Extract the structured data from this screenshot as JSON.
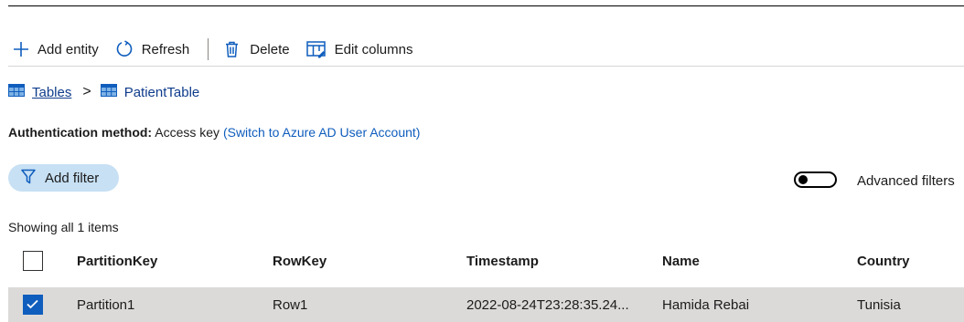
{
  "toolbar": {
    "add_label": "Add entity",
    "refresh_label": "Refresh",
    "delete_label": "Delete",
    "edit_columns_label": "Edit columns"
  },
  "breadcrumb": {
    "root": "Tables",
    "separator": ">",
    "current": "PatientTable"
  },
  "auth": {
    "label": "Authentication method:",
    "value": "Access key",
    "switch_link": "(Switch to Azure AD User Account)"
  },
  "filter": {
    "add_filter_label": "Add filter",
    "advanced_label": "Advanced filters",
    "advanced_on": false
  },
  "table": {
    "summary": "Showing all 1 items",
    "columns": [
      "PartitionKey",
      "RowKey",
      "Timestamp",
      "Name",
      "Country"
    ],
    "rows": [
      {
        "selected": true,
        "cells": [
          "Partition1",
          "Row1",
          "2022-08-24T23:28:35.24...",
          "Hamida Rebai",
          "Tunisia"
        ]
      }
    ]
  },
  "icons": {
    "add": "plus-icon",
    "refresh": "refresh-icon",
    "delete": "trash-icon",
    "edit_columns": "edit-columns-icon",
    "table": "table-icon",
    "filter": "filter-icon",
    "check": "checkmark-icon"
  },
  "colors": {
    "accent": "#0f5dbd",
    "link": "#0f3c8c",
    "pill_bg": "#c7e0f4",
    "selected_row_bg": "#dcdad8",
    "icon_blue": "#0f5dbd"
  }
}
